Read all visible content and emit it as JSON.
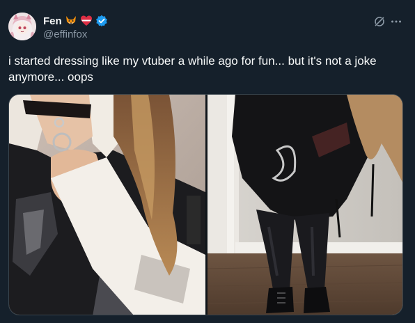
{
  "author": {
    "display_name": "Fen",
    "handle": "@effinfox",
    "badges": [
      "fox-emoji-icon",
      "heart-emoji-icon",
      "verified-badge-icon"
    ]
  },
  "tweet": {
    "text": "i started dressing like my vtuber a while ago for fun... but it's not a joke anymore... oops"
  },
  "actions": {
    "grok": "grok-icon",
    "more": "more-icon"
  },
  "media": [
    {
      "name": "photo-choker-shirt",
      "alt": ""
    },
    {
      "name": "photo-tights-boots",
      "alt": ""
    }
  ],
  "colors": {
    "background": "#15202b",
    "text": "#f7f9f9",
    "muted": "#8b98a5",
    "verified": "#1d9bf0",
    "border": "#38444d"
  }
}
